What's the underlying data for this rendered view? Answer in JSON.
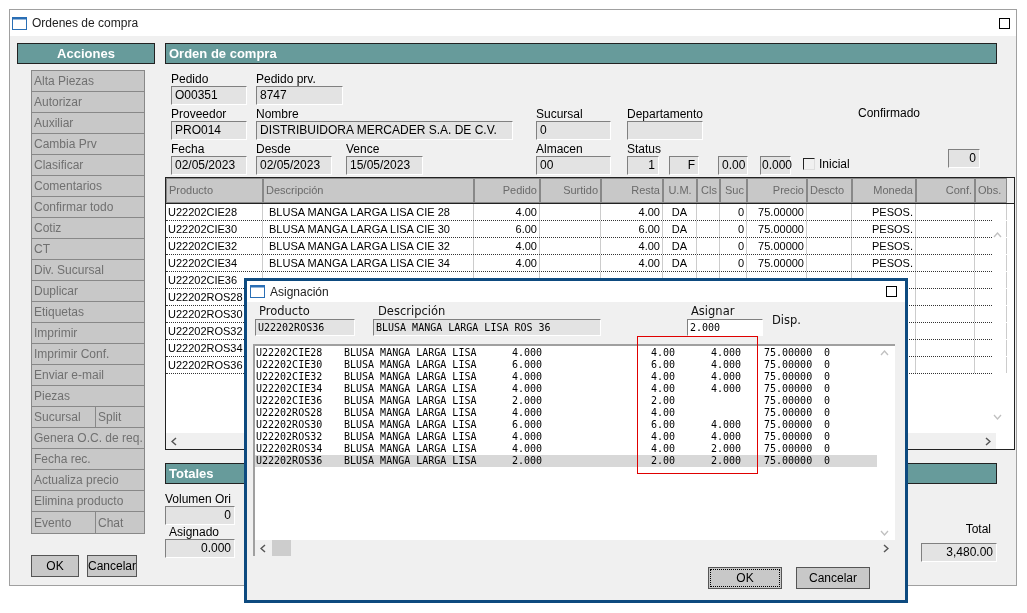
{
  "window": {
    "title": "Ordenes de compra"
  },
  "actions": {
    "title": "Acciones",
    "rows": [
      [
        "Alta Piezas"
      ],
      [
        "Autorizar"
      ],
      [
        "Auxiliar"
      ],
      [
        "Cambia Prv"
      ],
      [
        "Clasificar"
      ],
      [
        "Comentarios"
      ],
      [
        "Confirmar todo"
      ],
      [
        "Cotiz"
      ],
      [
        "CT"
      ],
      [
        "Div. Sucursal"
      ],
      [
        "Duplicar"
      ],
      [
        "Etiquetas"
      ],
      [
        "Imprimir"
      ],
      [
        "Imprimir Conf."
      ],
      [
        "Enviar e-mail"
      ],
      [
        "Piezas"
      ],
      [
        "Sucursal",
        "Split"
      ],
      [
        "Genera O.C. de req."
      ],
      [
        "Fecha rec."
      ],
      [
        "Actualiza precio"
      ],
      [
        "Elimina producto"
      ],
      [
        "Evento",
        "Chat"
      ]
    ]
  },
  "buttons": [
    "OK",
    "Cancelar"
  ],
  "order": {
    "title": "Orden de compra",
    "pedido": {
      "label": "Pedido",
      "value": "O00351"
    },
    "pedido_prv": {
      "label": "Pedido prv.",
      "value": "8747"
    },
    "proveedor": {
      "label": "Proveedor",
      "value": "PRO014"
    },
    "nombre": {
      "label": "Nombre",
      "value": "DISTRIBUIDORA MERCADER S.A. DE C.V."
    },
    "sucursal": {
      "label": "Sucursal",
      "value": "0"
    },
    "departamento": {
      "label": "Departamento"
    },
    "confirmado": {
      "label": "Confirmado",
      "value": "0"
    },
    "fecha": {
      "label": "Fecha",
      "value": "02/05/2023"
    },
    "desde": {
      "label": "Desde",
      "value": "02/05/2023"
    },
    "vence": {
      "label": "Vence",
      "value": "15/05/2023"
    },
    "almacen": {
      "label": "Almacen",
      "value": "00"
    },
    "status": {
      "label": "Status",
      "values": [
        "1",
        "F",
        "0.00",
        "0.000"
      ]
    },
    "inicial": {
      "label": "Inicial",
      "checked": false
    }
  },
  "table": {
    "columns": [
      "Producto",
      "Descripción",
      "Pedido",
      "Surtido",
      "Resta",
      "U.M.",
      "Cls",
      "Suc",
      "Precio",
      "Descto",
      "Moneda",
      "Conf.",
      "Obs."
    ],
    "rows": [
      {
        "cells": [
          "U22202CIE28",
          "BLUSA MANGA LARGA LISA CIE 28",
          "4.00",
          "",
          "4.00",
          "DA",
          "",
          "0",
          "75.00000",
          "",
          "PESOS.",
          "",
          ""
        ]
      },
      {
        "cells": [
          "U22202CIE30",
          "BLUSA MANGA LARGA LISA CIE 30",
          "6.00",
          "",
          "6.00",
          "DA",
          "",
          "0",
          "75.00000",
          "",
          "PESOS.",
          "",
          ""
        ]
      },
      {
        "cells": [
          "U22202CIE32",
          "BLUSA MANGA LARGA LISA CIE 32",
          "4.00",
          "",
          "4.00",
          "DA",
          "",
          "0",
          "75.00000",
          "",
          "PESOS.",
          "",
          ""
        ]
      },
      {
        "cells": [
          "U22202CIE34",
          "BLUSA MANGA LARGA LISA CIE 34",
          "4.00",
          "",
          "4.00",
          "DA",
          "",
          "0",
          "75.00000",
          "",
          "PESOS.",
          "",
          ""
        ]
      },
      {
        "cells": [
          "U22202CIE36"
        ]
      },
      {
        "cells": [
          "U22202ROS28"
        ]
      },
      {
        "cells": [
          "U22202ROS30"
        ]
      },
      {
        "cells": [
          "U22202ROS32"
        ]
      },
      {
        "cells": [
          "U22202ROS34"
        ]
      },
      {
        "cells": [
          "U22202ROS36"
        ]
      }
    ]
  },
  "totals": {
    "title": "Totales",
    "volumen": {
      "label": "Volumen Ori",
      "value": "0"
    },
    "asignado": {
      "label": "Asignado",
      "value": "0.000"
    },
    "total": {
      "label": "Total",
      "value": "3,480.00"
    }
  },
  "dialog": {
    "title": "Asignación",
    "producto": {
      "label": "Producto",
      "value": "U22202ROS36"
    },
    "descripcion": {
      "label": "Descripción",
      "value": "BLUSA MANGA LARGA LISA ROS 36"
    },
    "asignar": {
      "label": "Asignar",
      "value": "2.000"
    },
    "disp": {
      "label": "Disp."
    },
    "rows": [
      {
        "selected": false,
        "cells": [
          "U22202CIE28",
          "BLUSA MANGA LARGA LISA",
          "4.000",
          "4.00",
          "4.000",
          "75.00000",
          "0"
        ]
      },
      {
        "selected": false,
        "cells": [
          "U22202CIE30",
          "BLUSA MANGA LARGA LISA",
          "6.000",
          "6.00",
          "4.000",
          "75.00000",
          "0"
        ]
      },
      {
        "selected": false,
        "cells": [
          "U22202CIE32",
          "BLUSA MANGA LARGA LISA",
          "4.000",
          "4.00",
          "4.000",
          "75.00000",
          "0"
        ]
      },
      {
        "selected": false,
        "cells": [
          "U22202CIE34",
          "BLUSA MANGA LARGA LISA",
          "4.000",
          "4.00",
          "4.000",
          "75.00000",
          "0"
        ]
      },
      {
        "selected": false,
        "cells": [
          "U22202CIE36",
          "BLUSA MANGA LARGA LISA",
          "2.000",
          "2.00",
          "",
          "75.00000",
          "0"
        ]
      },
      {
        "selected": false,
        "cells": [
          "U22202ROS28",
          "BLUSA MANGA LARGA LISA",
          "4.000",
          "4.00",
          "",
          "75.00000",
          "0"
        ]
      },
      {
        "selected": false,
        "cells": [
          "U22202ROS30",
          "BLUSA MANGA LARGA LISA",
          "6.000",
          "6.00",
          "4.000",
          "75.00000",
          "0"
        ]
      },
      {
        "selected": false,
        "cells": [
          "U22202ROS32",
          "BLUSA MANGA LARGA LISA",
          "4.000",
          "4.00",
          "4.000",
          "75.00000",
          "0"
        ]
      },
      {
        "selected": false,
        "cells": [
          "U22202ROS34",
          "BLUSA MANGA LARGA LISA",
          "4.000",
          "4.00",
          "2.000",
          "75.00000",
          "0"
        ]
      },
      {
        "selected": true,
        "cells": [
          "U22202ROS36",
          "BLUSA MANGA LARGA LISA",
          "2.000",
          "2.00",
          "2.000",
          "75.00000",
          "0"
        ]
      }
    ],
    "buttons": [
      "OK",
      "Cancelar"
    ]
  }
}
